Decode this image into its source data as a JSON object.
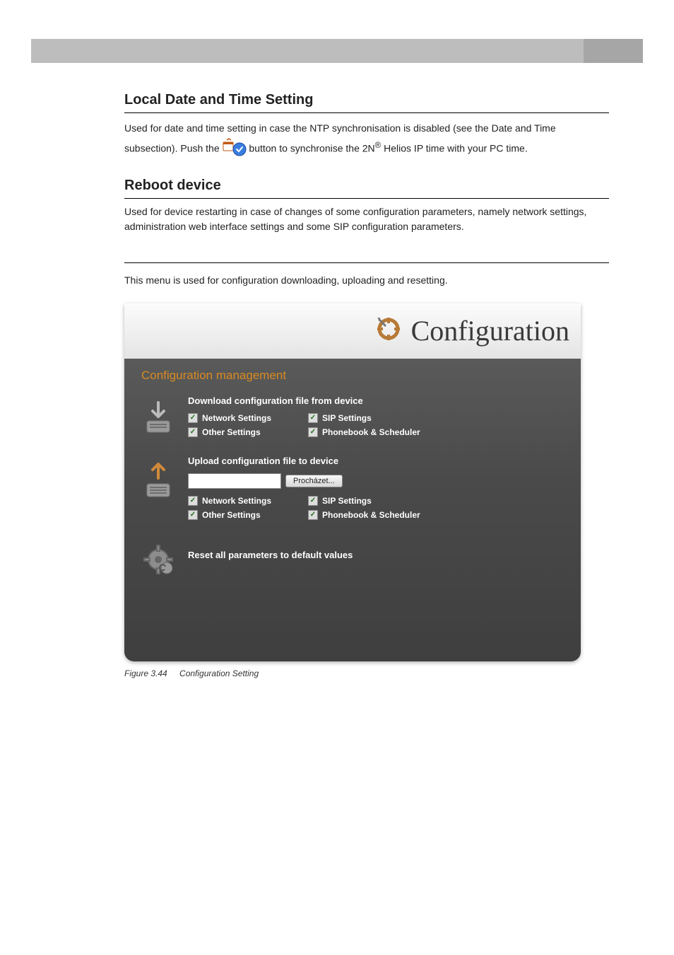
{
  "sections": {
    "local": {
      "title": "Local Date and Time Setting",
      "para_before_icon": "Used for date and time setting in case the NTP synchronisation is disabled (see the Date and Time subsection). Push the ",
      "para_after_icon": " button to synchronise the 2N",
      "reg": "®",
      "para_tail": " Helios IP time with your PC time."
    },
    "reboot": {
      "title": "Reboot device",
      "para": "Used for device restarting in case of changes of some configuration parameters, namely network settings, administration web interface settings and some SIP configuration parameters."
    },
    "config_intro": "This menu is used for configuration downloading, uploading and resetting."
  },
  "screenshot": {
    "header_title": "Configuration",
    "panel_title": "Configuration management",
    "download": {
      "title": "Download configuration file from device",
      "opts": [
        "Network Settings",
        "SIP Settings",
        "Other Settings",
        "Phonebook & Scheduler"
      ]
    },
    "upload": {
      "title": "Upload configuration file to device",
      "browse": "Procházet...",
      "opts": [
        "Network Settings",
        "SIP Settings",
        "Other Settings",
        "Phonebook & Scheduler"
      ]
    },
    "reset": {
      "title": "Reset all parameters to default values"
    }
  },
  "figure": {
    "num": "Figure 3.44",
    "caption": "Configuration Setting"
  }
}
